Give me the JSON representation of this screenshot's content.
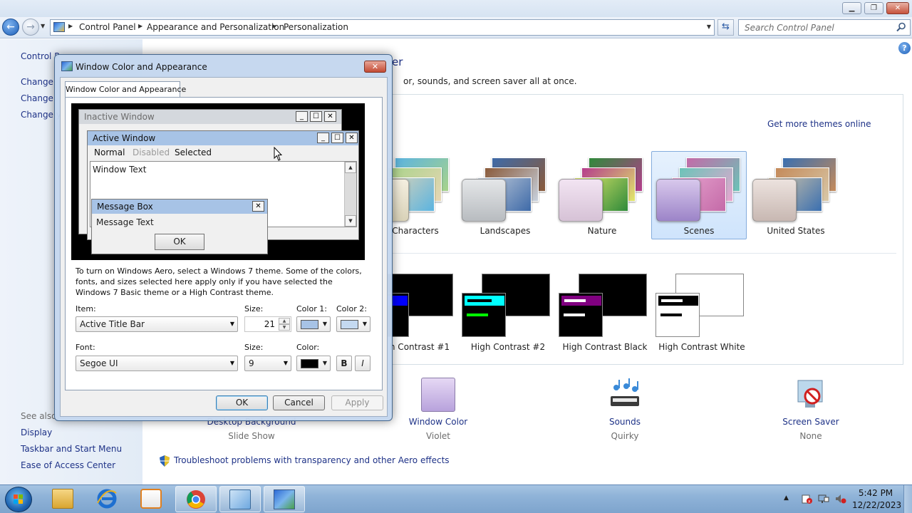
{
  "window": {
    "nav": {
      "crumbs": [
        "Control Panel",
        "Appearance and Personalization",
        "Personalization"
      ],
      "search_placeholder": "Search Control Panel"
    }
  },
  "left_pane": {
    "control_panel_home": "Control P",
    "links": [
      "Change",
      "Change",
      "Change y"
    ],
    "see_also": "See also",
    "see_also_links": [
      "Display",
      "Taskbar and Start Menu",
      "Ease of Access Center"
    ]
  },
  "main": {
    "title": "er",
    "description": "or, sounds, and screen saver all at once.",
    "get_more": "Get more themes online",
    "themes": [
      {
        "label": "Characters",
        "colors": [
          "#5bb4e0",
          "#a8d38a",
          "#e7d6b4"
        ]
      },
      {
        "label": "Landscapes",
        "colors": [
          "#3e6aa8",
          "#8a5a3a",
          "#c7d0dc"
        ]
      },
      {
        "label": "Nature",
        "colors": [
          "#2f8a3a",
          "#b53c8c",
          "#e0e86a"
        ]
      },
      {
        "label": "Scenes",
        "colors": [
          "#c46aa8",
          "#6ac4b8",
          "#e8a6d0"
        ]
      },
      {
        "label": "United States",
        "colors": [
          "#3a6fb0",
          "#c48a5a",
          "#d8c8a8"
        ]
      }
    ],
    "high_contrast": [
      {
        "label": "h Contrast #1",
        "bar": "#0000ff",
        "line": "#ffffff",
        "back": "#000000",
        "front": "#000000"
      },
      {
        "label": "High Contrast #2",
        "bar": "#00ffff",
        "line": "#00ff00",
        "back": "#000000",
        "front": "#000000"
      },
      {
        "label": "High Contrast Black",
        "bar": "#800080",
        "line": "#ffffff",
        "back": "#000000",
        "front": "#000000"
      },
      {
        "label": "High Contrast White",
        "bar": "#000000",
        "line": "#000000",
        "back": "#ffffff",
        "front": "#ffffff"
      }
    ],
    "bottom": [
      {
        "link": "Desktop Background",
        "sub": "Slide Show"
      },
      {
        "link": "Window Color",
        "sub": "Violet"
      },
      {
        "link": "Sounds",
        "sub": "Quirky"
      },
      {
        "link": "Screen Saver",
        "sub": "None"
      }
    ],
    "troubleshoot": "Troubleshoot problems with transparency and other Aero effects"
  },
  "dialog": {
    "title": "Window Color and Appearance",
    "tab": "Window Color and Appearance",
    "preview": {
      "inactive_title": "Inactive Window",
      "active_title": "Active Window",
      "menu_normal": "Normal",
      "menu_disabled": "Disabled",
      "menu_selected": "Selected",
      "window_text": "Window Text",
      "message_box_title": "Message Box",
      "message_text": "Message Text",
      "ok": "OK"
    },
    "help_text": "To turn on Windows Aero, select a Windows 7 theme.  Some of the colors, fonts, and sizes selected here apply only if you have selected the Windows 7 Basic theme or a High Contrast theme.",
    "item_label": "Item:",
    "item_value": "Active Title Bar",
    "item_size_label": "Size:",
    "item_size_value": "21",
    "color1_label": "Color 1:",
    "color1": "#a7c3e6",
    "color2_label": "Color 2:",
    "color2": "#c4d9f0",
    "font_label": "Font:",
    "font_value": "Segoe UI",
    "font_size_label": "Size:",
    "font_size_value": "9",
    "font_color_label": "Color:",
    "font_color": "#000000",
    "bold": "B",
    "italic": "I",
    "ok": "OK",
    "cancel": "Cancel",
    "apply": "Apply"
  },
  "taskbar": {
    "time": "5:42 PM",
    "date": "12/22/2023"
  }
}
